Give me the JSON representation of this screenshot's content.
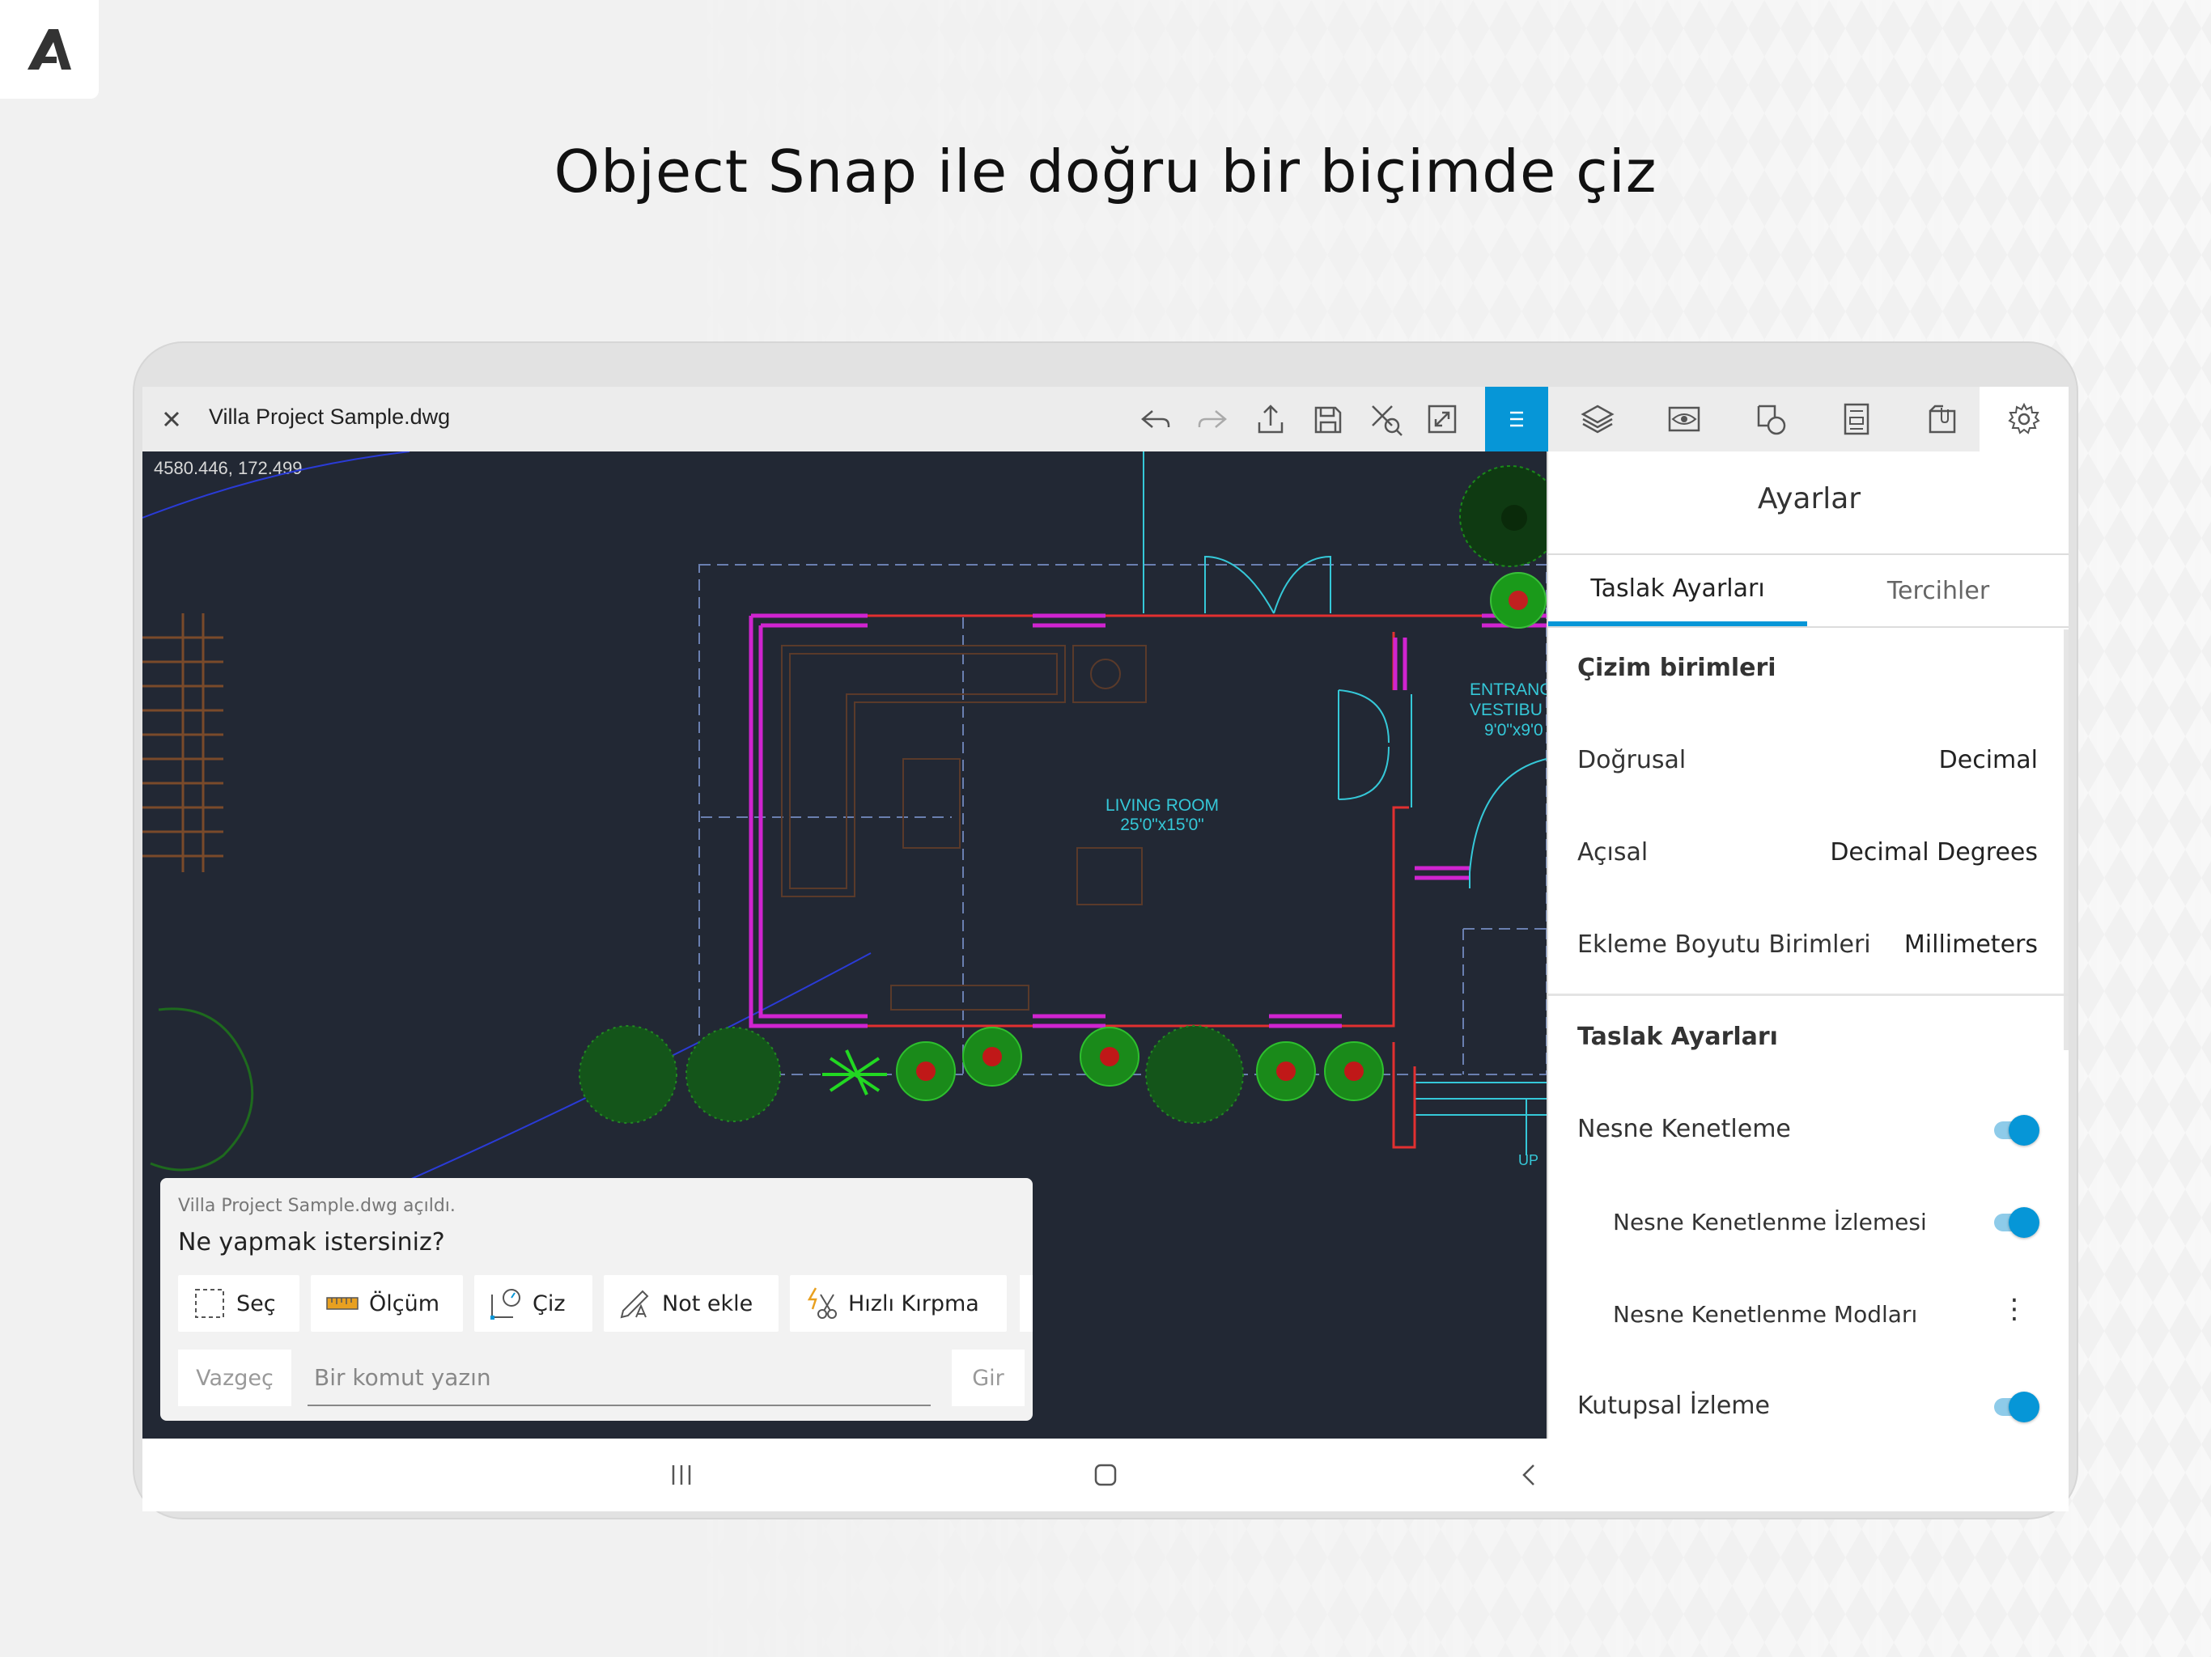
{
  "headline": "Object Snap ile doğru bir biçimde çiz",
  "app": {
    "file_name": "Villa Project Sample.dwg",
    "coordinates": "4580.446, 172.499"
  },
  "toolbar": {
    "icons": [
      "undo-icon",
      "redo-icon",
      "share-icon",
      "save-icon",
      "trim-icon",
      "fullscreen-icon",
      "menu-icon",
      "layers-icon",
      "view-icon",
      "draw-icon",
      "properties-icon",
      "attachments-icon",
      "settings-icon"
    ],
    "active_tool": "menu-icon",
    "accent_color": "#0696d7"
  },
  "drawing": {
    "room_label_1": "LIVING ROOM",
    "room_label_2": "25'0\"x15'0\"",
    "entrance_label_1": "ENTRANC",
    "entrance_label_2": "VESTIBU",
    "entrance_label_3": "9'0\"x9'0",
    "stair_label": "UP"
  },
  "settings": {
    "title": "Ayarlar",
    "tabs": [
      {
        "label": "Taslak Ayarları",
        "active": true
      },
      {
        "label": "Tercihler",
        "active": false
      }
    ],
    "units_header": "Çizim birimleri",
    "rows": [
      {
        "label": "Doğrusal",
        "value": "Decimal"
      },
      {
        "label": "Açısal",
        "value": "Decimal Degrees"
      },
      {
        "label": "Ekleme Boyutu Birimleri",
        "value": "Millimeters"
      }
    ],
    "draft_header": "Taslak Ayarları",
    "toggles": [
      {
        "label": "Nesne Kenetleme",
        "on": true
      },
      {
        "label": "Nesne Kenetlenme İzlemesi",
        "on": true
      }
    ],
    "modes_label": "Nesne Kenetlenme Modları",
    "polar_label": "Kutupsal İzleme",
    "polar_on": true
  },
  "command": {
    "status": "Villa Project Sample.dwg açıldı.",
    "question": "Ne yapmak istersiniz?",
    "buttons": [
      {
        "label": "Seç",
        "icon": "select-icon"
      },
      {
        "label": "Ölçüm",
        "icon": "ruler-icon"
      },
      {
        "label": "Çiz",
        "icon": "draw-icon"
      },
      {
        "label": "Not ekle",
        "icon": "annotate-icon"
      },
      {
        "label": "Hızlı Kırpma",
        "icon": "quick-trim-icon"
      }
    ],
    "cancel_label": "Vazgeç",
    "input_placeholder": "Bir komut yazın",
    "enter_label": "Gir"
  },
  "nav": {
    "icons": [
      "recent-apps-icon",
      "home-icon",
      "back-icon"
    ]
  }
}
